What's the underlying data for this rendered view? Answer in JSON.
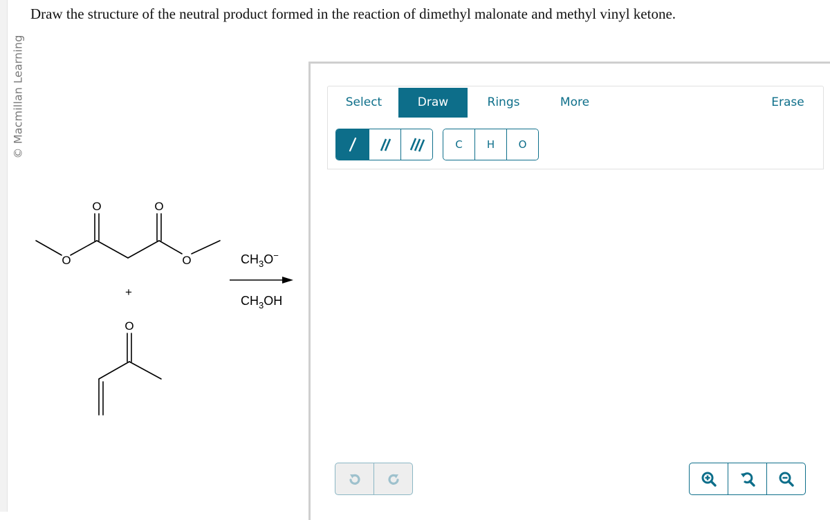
{
  "copyright": "© Macmillan Learning",
  "question": "Draw the structure of the neutral product formed in the reaction of dimethyl malonate and methyl vinyl ketone.",
  "scheme": {
    "reactant_1": {
      "name": "dimethyl malonate",
      "atom_labels": {
        "o_carbonyl_left": "O",
        "o_carbonyl_right": "O",
        "o_ester_left": "O",
        "o_ester_right": "O"
      }
    },
    "plus": "+",
    "reactant_2": {
      "name": "methyl vinyl ketone",
      "atom_labels": {
        "o_carbonyl": "O"
      }
    },
    "reagent_above": {
      "main": "CH",
      "sub": "3",
      "tail": "O",
      "sup": "−"
    },
    "reagent_below": {
      "main": "CH",
      "sub": "3",
      "tail": "OH"
    }
  },
  "editor": {
    "tabs": [
      {
        "label": "Select",
        "active": false
      },
      {
        "label": "Draw",
        "active": true
      },
      {
        "label": "Rings",
        "active": false
      },
      {
        "label": "More",
        "active": false
      },
      {
        "label": "Erase",
        "active": false
      }
    ],
    "bond_tools": [
      {
        "name": "single-bond",
        "glyph": "/",
        "active": true
      },
      {
        "name": "double-bond",
        "glyph": "//",
        "active": false
      },
      {
        "name": "triple-bond",
        "glyph": "///",
        "active": false
      }
    ],
    "atom_tools": [
      {
        "label": "C"
      },
      {
        "label": "H"
      },
      {
        "label": "O"
      }
    ],
    "history_buttons": [
      "undo",
      "redo"
    ],
    "view_buttons": [
      "zoom-in",
      "reset-zoom",
      "zoom-out"
    ],
    "colors": {
      "accent": "#0d6e8a",
      "disabled_border": "#8bb6c4",
      "disabled_icon": "#9ec1cd",
      "disabled_bg": "#eeeeee"
    }
  }
}
